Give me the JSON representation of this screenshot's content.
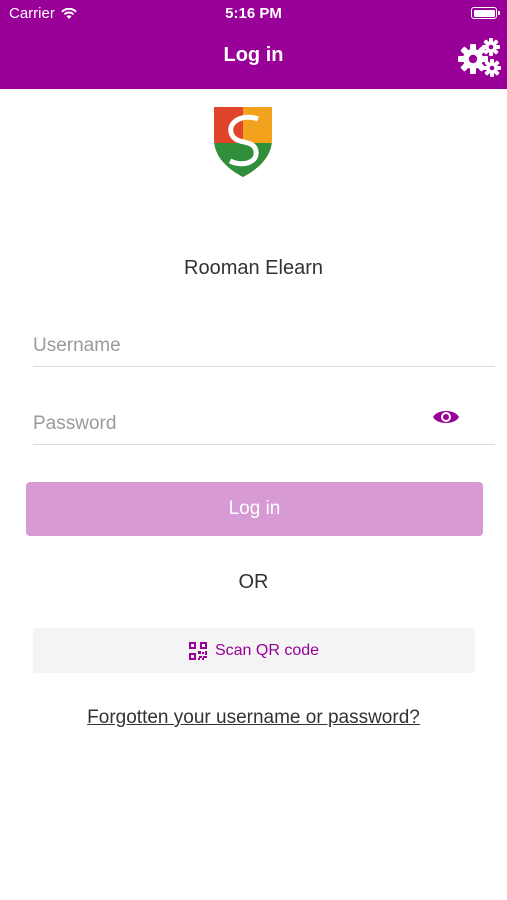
{
  "status_bar": {
    "carrier": "Carrier",
    "time": "5:16 PM"
  },
  "nav": {
    "title": "Log in",
    "settings_icon": "gears-icon"
  },
  "app": {
    "name": "Rooman Elearn"
  },
  "form": {
    "username_placeholder": "Username",
    "password_placeholder": "Password",
    "login_label": "Log in",
    "or_label": "OR",
    "scan_qr_label": "Scan QR code",
    "forgot_link": "Forgotten your username or password?"
  },
  "colors": {
    "primary": "#980098",
    "login_button": "#d89ad4",
    "qr_button_bg": "#f4f4f4"
  }
}
